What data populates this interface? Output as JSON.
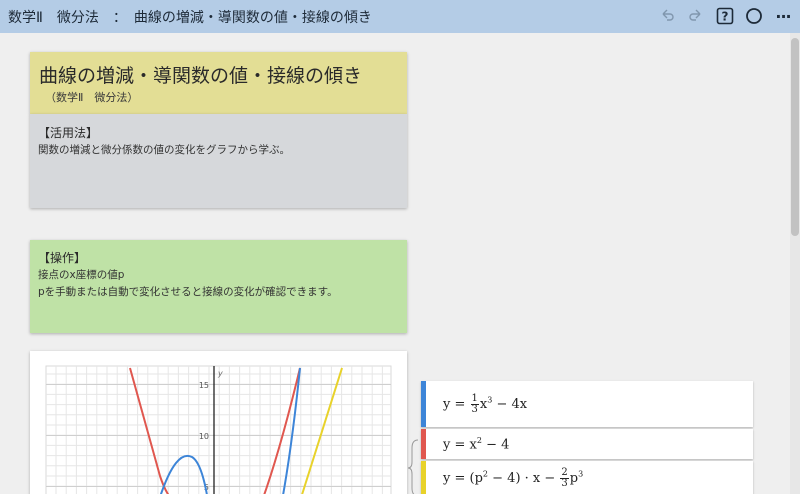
{
  "header": {
    "title": "数学Ⅱ　微分法　：　曲線の増減・導関数の値・接線の傾き",
    "tools": [
      "undo-icon",
      "redo-icon",
      "help-icon",
      "circle-icon",
      "more-icon"
    ],
    "help_label": "?",
    "more_label": "···"
  },
  "title_card": {
    "title": "曲線の増減・導関数の値・接線の傾き",
    "subtitle": "（数学Ⅱ　微分法）",
    "color": "#e3de95"
  },
  "usage_card": {
    "heading": "【活用法】",
    "lines": [
      "関数の増減と微分係数の値の変化をグラフから学ぶ。"
    ],
    "color": "#d6d8db"
  },
  "op_card": {
    "heading": "【操作】",
    "lines": [
      "接点のx座標の値p",
      "pを手動または自動で変化させると接線の変化が確認できます。"
    ],
    "color": "#bfe2a6"
  },
  "graph": {
    "axis_label_y": "y",
    "y_ticks": [
      "15",
      "10",
      "5"
    ],
    "colors": {
      "cubic": "#3d85d8",
      "quadratic": "#e0574f",
      "tangent": "#e8d22a"
    }
  },
  "expressions": [
    {
      "color": "#3d85d8",
      "y": "y =",
      "frac_n": "1",
      "frac_d": "3",
      "rest_a": "x",
      "sup_a": "3",
      "rest_b": " − 4x"
    },
    {
      "color": "#e0574f",
      "y": "y =",
      "rest_a": "x",
      "sup_a": "2",
      "rest_b": " − 4"
    },
    {
      "color": "#e8d22a",
      "y": "y =",
      "part1": "(p",
      "sup1": "2",
      "part2": " − 4) · x − ",
      "frac_n": "2",
      "frac_d": "3",
      "part3": "p",
      "sup3": "3"
    }
  ]
}
